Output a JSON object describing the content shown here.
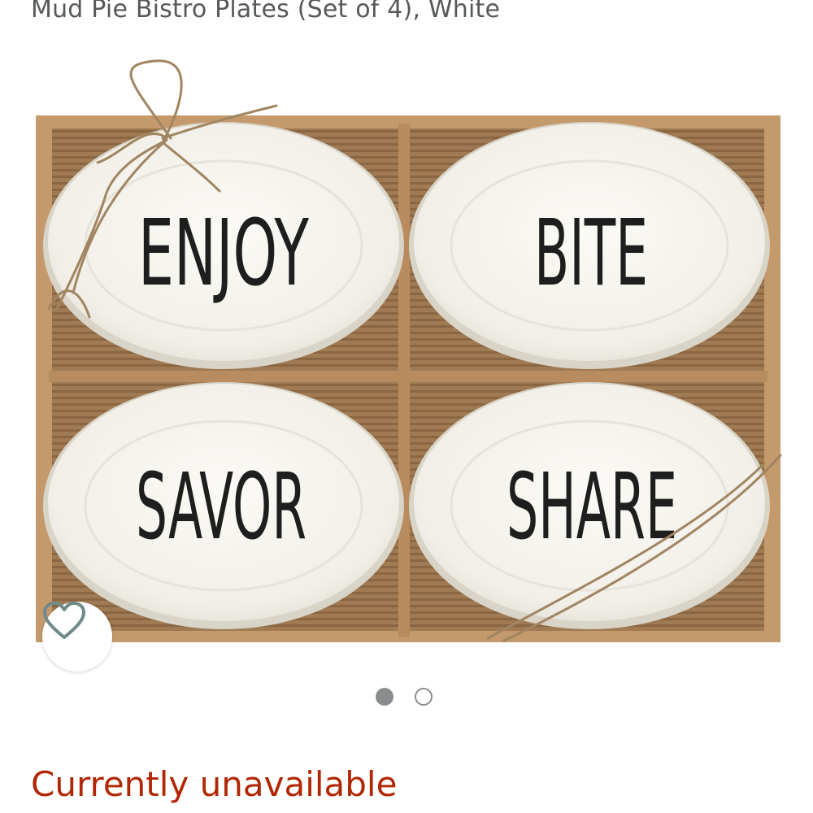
{
  "product": {
    "title": "Mud Pie Bistro Plates (Set of 4), White",
    "availability": "Currently unavailable",
    "availability_color": "#B12704"
  },
  "gallery": {
    "plate_words": [
      "ENJOY",
      "BITE",
      "SAVOR",
      "SHARE"
    ],
    "image_count": 2,
    "active_index": 1,
    "wishlist_icon": "heart-icon"
  }
}
